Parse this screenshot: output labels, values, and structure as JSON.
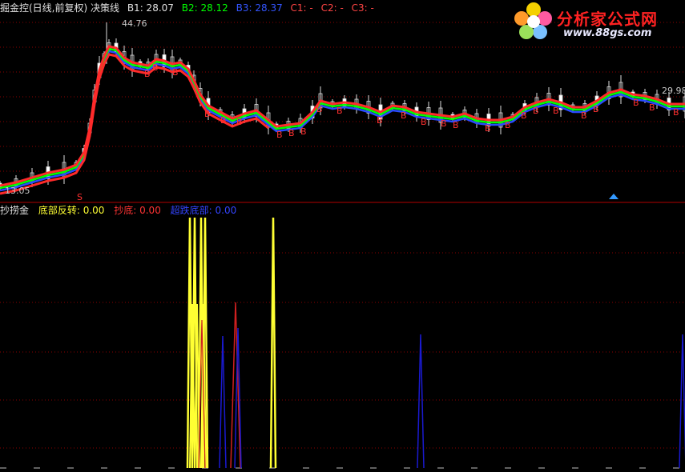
{
  "upper": {
    "indicator_name": "掘金控(日线,前复权) 决策线",
    "b1_label": "B1: 28.07",
    "b2_label": "B2: 28.12",
    "b3_label": "B3: 28.37",
    "c1_label": "C1: -",
    "c2_label": "C2: -",
    "c3_label": "C3: -",
    "high_price": "44.76",
    "low_price": "13.05",
    "last_price": "29.98",
    "buy_marker": "B",
    "signal_marker": "S"
  },
  "lower": {
    "indicator_name": "抄捞金",
    "bottom_reversal_label": "底部反转: 0.00",
    "bottom_pick_label": "抄底: 0.00",
    "super_bottom_label": "超跌底部: 0.00"
  },
  "logo": {
    "title": "分析家公式网",
    "url": "www.88gs.com"
  },
  "colors": {
    "background": "#000000",
    "grid": "#8b0000",
    "up_candle": "#dcdcdc",
    "bright_red_line": "#ff2a2a",
    "green_line": "#00ff00",
    "blue_line": "#2a4bff",
    "yellow": "#ffff33",
    "navy": "#1a1ad0",
    "label_white": "#e0e0e0"
  },
  "icons": [
    "logo-flower-icon",
    "up-arrow-icon"
  ]
}
